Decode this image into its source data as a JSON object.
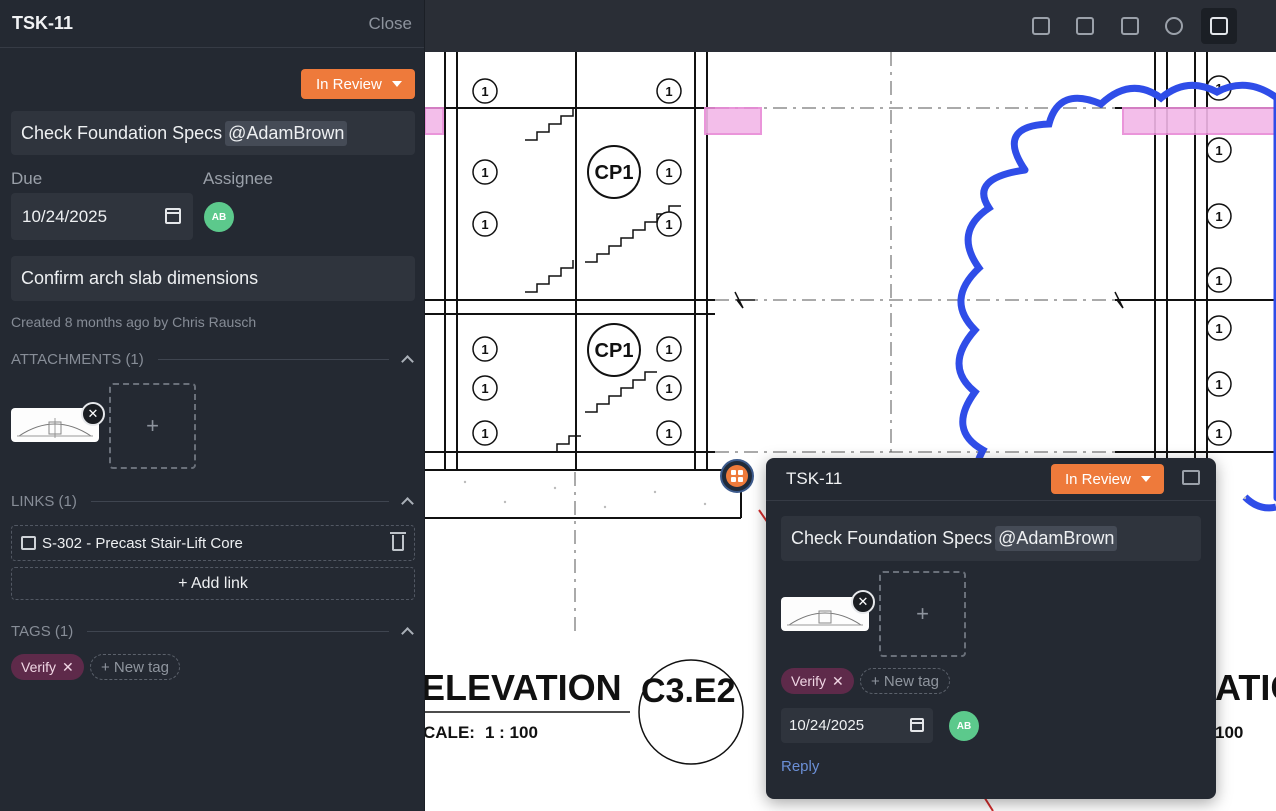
{
  "task": {
    "id": "TSK-11",
    "close_label": "Close",
    "status": "In Review",
    "title_text": "Check Foundation Specs",
    "mention": "@AdamBrown",
    "due_label": "Due",
    "due_date": "10/24/2025",
    "assignee_label": "Assignee",
    "assignee_initials": "AB",
    "description": "Confirm arch slab dimensions",
    "created": "Created 8 months ago by Chris Rausch"
  },
  "attachments": {
    "header": "ATTACHMENTS (1)",
    "add": "+"
  },
  "links": {
    "header": "LINKS (1)",
    "items": [
      {
        "label": "S-302 - Precast Stair-Lift Core"
      }
    ],
    "add_label": "+ Add link"
  },
  "tags": {
    "header": "TAGS (1)",
    "items": [
      {
        "label": "Verify"
      }
    ],
    "new_label": "+ New tag"
  },
  "toolbar": {
    "tools": [
      "text-tool-icon",
      "comment-tool-icon",
      "image-tool-icon",
      "link-tool-icon",
      "stamp-tool-icon"
    ],
    "active": "stamp-tool-icon"
  },
  "drawing": {
    "labels": [
      "CP1",
      "CP1",
      "1"
    ],
    "elev_text_left": "ELEVATION",
    "elev_ref": "C3.E2",
    "scale_text": "CALE:",
    "scale_value": "1 : 100",
    "elev_text_right": "ATIC",
    "scale_right": "100"
  },
  "popup": {
    "id": "TSK-11",
    "status": "In Review",
    "title_text": "Check Foundation Specs",
    "mention": "@AdamBrown",
    "tag": "Verify",
    "new_tag": "+ New tag",
    "due_date": "10/24/2025",
    "assignee_initials": "AB",
    "reply_label": "Reply"
  },
  "colors": {
    "status_orange": "#ee7a3b",
    "tag_bg": "#5e2a4a",
    "avatar_green": "#5cc98c",
    "cloud_blue": "#2f4de8",
    "highlight_pink": "#e88ad6"
  }
}
